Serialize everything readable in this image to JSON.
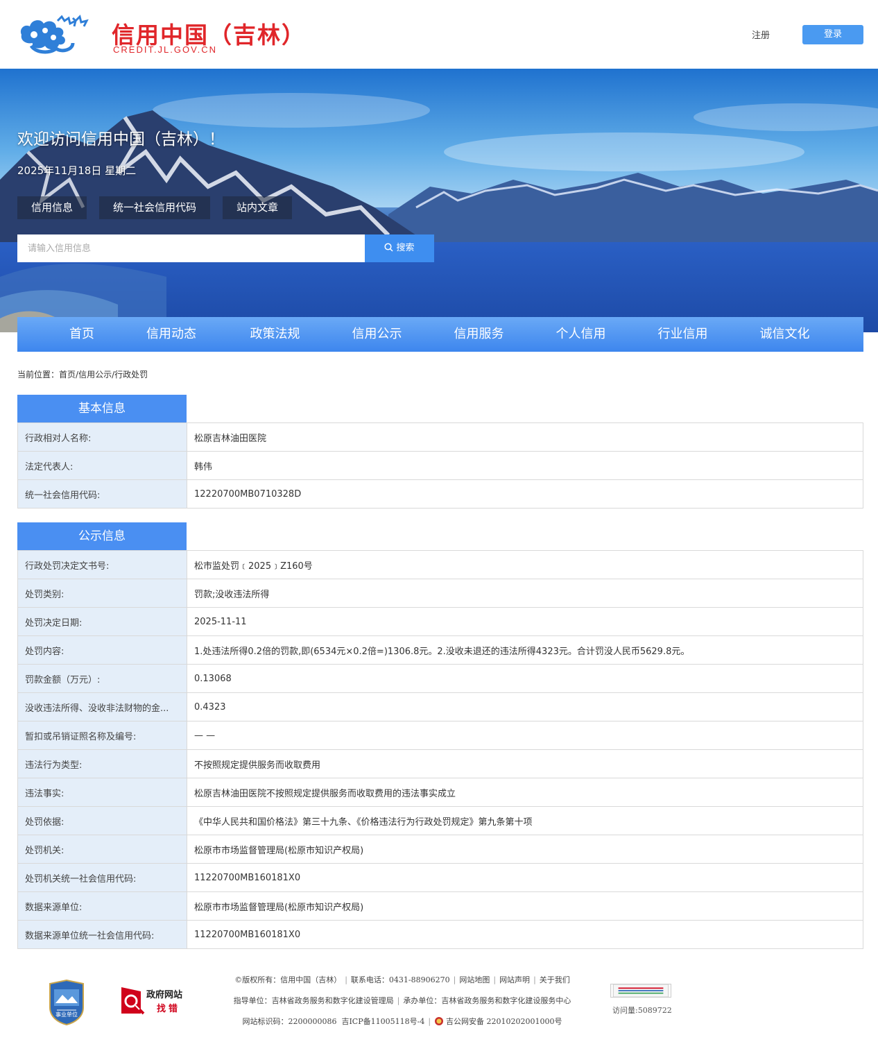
{
  "header": {
    "logo_title": "信用中国（吉林）",
    "logo_sub": "CREDIT.JL.GOV.CN",
    "register_label": "注册",
    "login_label": "登录"
  },
  "banner": {
    "welcome": "欢迎访问信用中国（吉林）！",
    "date": "2025年11月18日 星期二",
    "search_tabs": [
      "信用信息",
      "统一社会信用代码",
      "站内文章"
    ],
    "search_placeholder": "请输入信用信息",
    "search_button": "搜索"
  },
  "nav": {
    "items": [
      "首页",
      "信用动态",
      "政策法规",
      "信用公示",
      "信用服务",
      "个人信用",
      "行业信用",
      "诚信文化"
    ]
  },
  "breadcrumb": {
    "prefix": "当前位置：",
    "home": "首页",
    "sep": "/",
    "level1": "信用公示",
    "level2": "行政处罚"
  },
  "basic_info": {
    "title": "基本信息",
    "rows": [
      {
        "label": "行政相对人名称:",
        "value": "松原吉林油田医院"
      },
      {
        "label": "法定代表人:",
        "value": "韩伟"
      },
      {
        "label": "统一社会信用代码:",
        "value": "12220700MB0710328D"
      }
    ]
  },
  "public_info": {
    "title": "公示信息",
    "rows": [
      {
        "label": "行政处罚决定文书号:",
        "value": "松市监处罚﹝2025﹞Z160号"
      },
      {
        "label": "处罚类别:",
        "value": "罚款;没收违法所得"
      },
      {
        "label": "处罚决定日期:",
        "value": "2025-11-11"
      },
      {
        "label": "处罚内容:",
        "value": "1.处违法所得0.2倍的罚款,即(6534元×0.2倍=)1306.8元。2.没收未退还的违法所得4323元。合计罚没人民币5629.8元。"
      },
      {
        "label": "罚款金额（万元）:",
        "value": "0.13068"
      },
      {
        "label": "没收违法所得、没收非法财物的金...",
        "value": "0.4323"
      },
      {
        "label": "暂扣或吊销证照名称及编号:",
        "value": "— —"
      },
      {
        "label": "违法行为类型:",
        "value": "不按照规定提供服务而收取费用"
      },
      {
        "label": "违法事实:",
        "value": "松原吉林油田医院不按照规定提供服务而收取费用的违法事实成立"
      },
      {
        "label": "处罚依据:",
        "value": "《中华人民共和国价格法》第三十九条、《价格违法行为行政处罚规定》第九条第十项"
      },
      {
        "label": "处罚机关:",
        "value": "松原市市场监督管理局(松原市知识产权局)"
      },
      {
        "label": "处罚机关统一社会信用代码:",
        "value": "11220700MB160181X0"
      },
      {
        "label": "数据来源单位:",
        "value": "松原市市场监督管理局(松原市知识产权局)"
      },
      {
        "label": "数据来源单位统一社会信用代码:",
        "value": "11220700MB160181X0"
      }
    ]
  },
  "footer": {
    "badge_text": "事业单位",
    "gov_correct_line1": "政府网站",
    "gov_correct_line2": "找错",
    "copyright": "©版权所有：信用中国（吉林）",
    "phone": "联系电话：0431-88906270",
    "sitemap": "网站地图",
    "statement": "网站声明",
    "about": "关于我们",
    "guide_unit": "指导单位：吉林省政务服务和数字化建设管理局",
    "host_unit": "承办单位：吉林省政务服务和数字化建设服务中心",
    "site_id": "网站标识码：2200000086",
    "icp": "吉ICP备11005118号-4",
    "police": "吉公网安备 22010202001000号",
    "visits": "访问量:5089722"
  },
  "colors": {
    "brand_red": "#e0262a",
    "accent_blue": "#4a8ff2",
    "label_bg": "#e4eef9"
  }
}
